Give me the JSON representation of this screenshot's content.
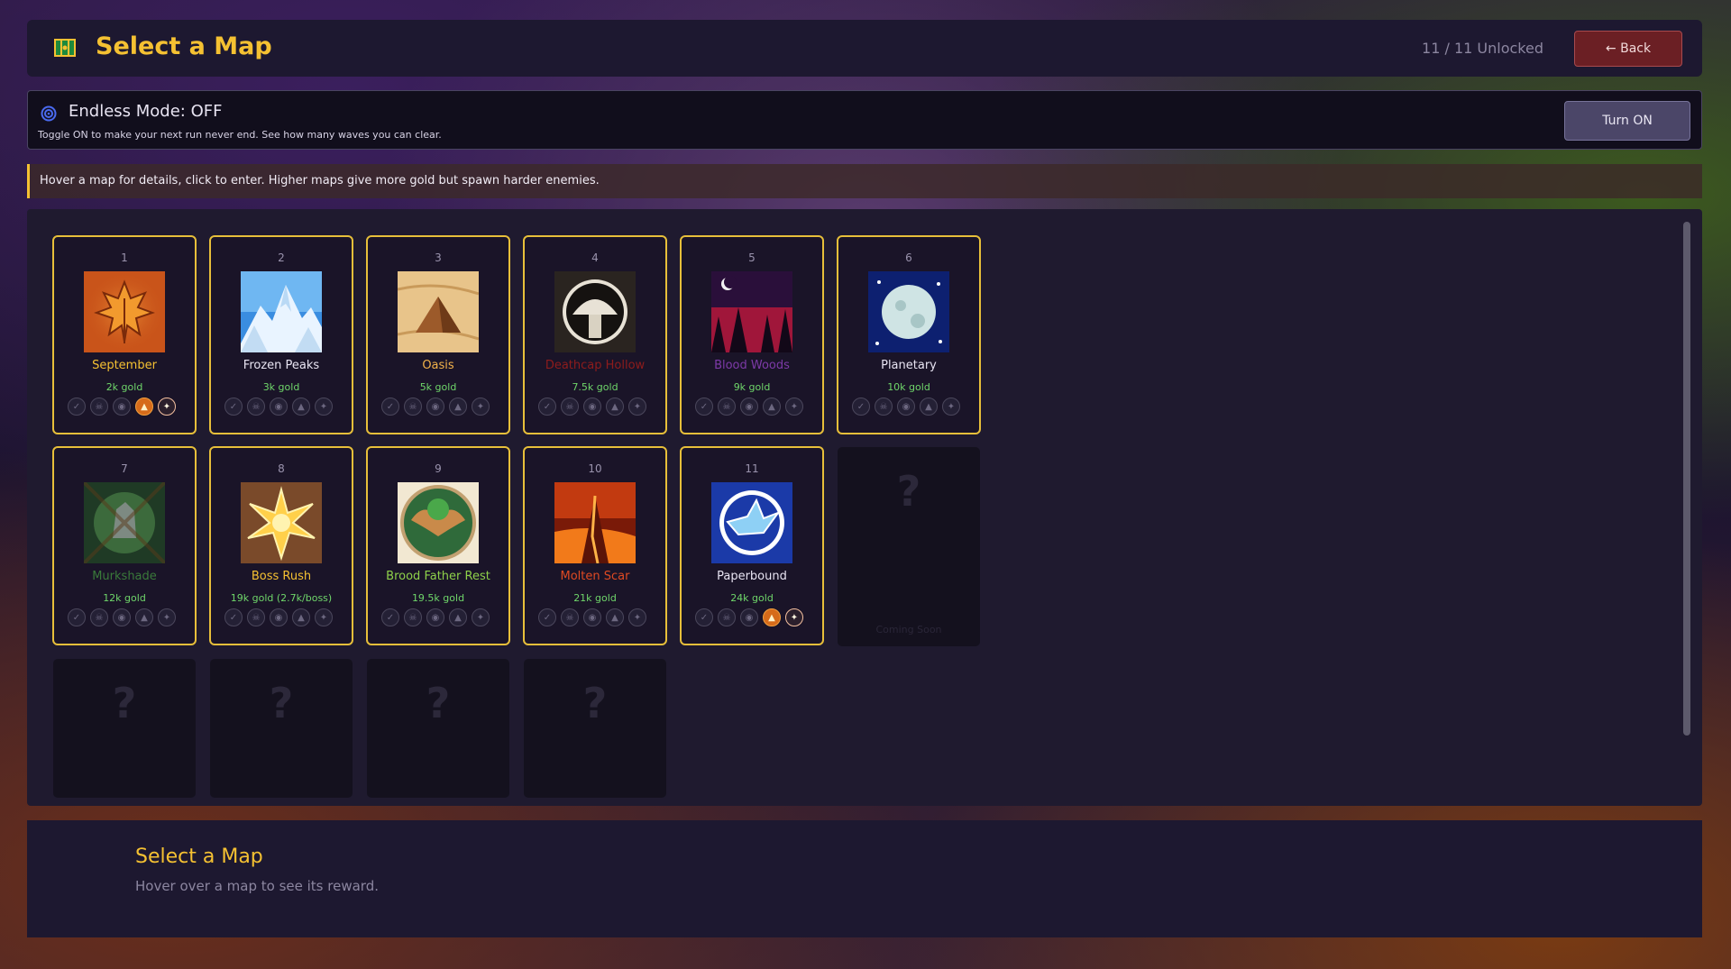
{
  "header": {
    "title": "Select a Map",
    "unlocked": "11 / 11 Unlocked",
    "back_label": "← Back"
  },
  "endless": {
    "title": "Endless Mode: OFF",
    "subtitle": "Toggle ON to make your next run never end. See how many waves you can clear.",
    "button_label": "Turn ON"
  },
  "hint": "Hover a map for details, click to enter. Higher maps give more gold but spawn harder enemies.",
  "maps": [
    {
      "num": "1",
      "name": "September",
      "gold": "2k gold",
      "name_color": "#f5c132",
      "theme": "autumn",
      "fire": true,
      "star": true
    },
    {
      "num": "2",
      "name": "Frozen Peaks",
      "gold": "3k gold",
      "name_color": "#e8e4f2",
      "theme": "frozen",
      "fire": false,
      "star": false
    },
    {
      "num": "3",
      "name": "Oasis",
      "gold": "5k gold",
      "name_color": "#f2b24a",
      "theme": "desert",
      "fire": false,
      "star": false
    },
    {
      "num": "4",
      "name": "Deathcap Hollow",
      "gold": "7.5k gold",
      "name_color": "#8e1c1c",
      "theme": "mushroom",
      "fire": false,
      "star": false
    },
    {
      "num": "5",
      "name": "Blood Woods",
      "gold": "9k gold",
      "name_color": "#7d3aa8",
      "theme": "blood",
      "fire": false,
      "star": false
    },
    {
      "num": "6",
      "name": "Planetary",
      "gold": "10k gold",
      "name_color": "#e8e4f2",
      "theme": "moon",
      "fire": false,
      "star": false
    },
    {
      "num": "7",
      "name": "Murkshade",
      "gold": "12k gold",
      "name_color": "#3a7a3a",
      "theme": "murk",
      "fire": false,
      "star": false
    },
    {
      "num": "8",
      "name": "Boss Rush",
      "gold": "19k gold (2.7k/boss)",
      "name_color": "#f5c132",
      "theme": "boss",
      "fire": false,
      "star": false
    },
    {
      "num": "9",
      "name": "Brood Father Rest",
      "gold": "19.5k gold",
      "name_color": "#8ed14a",
      "theme": "brood",
      "fire": false,
      "star": false
    },
    {
      "num": "10",
      "name": "Molten Scar",
      "gold": "21k gold",
      "name_color": "#e04a22",
      "theme": "molten",
      "fire": false,
      "star": false
    },
    {
      "num": "11",
      "name": "Paperbound",
      "gold": "24k gold",
      "name_color": "#e8e4f2",
      "theme": "paper",
      "fire": true,
      "star": true
    }
  ],
  "locked": {
    "question": "?",
    "coming_soon": "Coming Soon"
  },
  "footer": {
    "title": "Select a Map",
    "subtitle": "Hover over a map to see its reward."
  },
  "icons": [
    "map-icon",
    "endless-spiral-icon",
    "check-icon",
    "skull-icon",
    "eye-icon",
    "fire-icon",
    "star-icon"
  ],
  "colors": {
    "accent": "#f5c132",
    "card_border": "#e7bf3a",
    "gold_text": "#6fd66a",
    "back_button": "#6b1f24"
  }
}
